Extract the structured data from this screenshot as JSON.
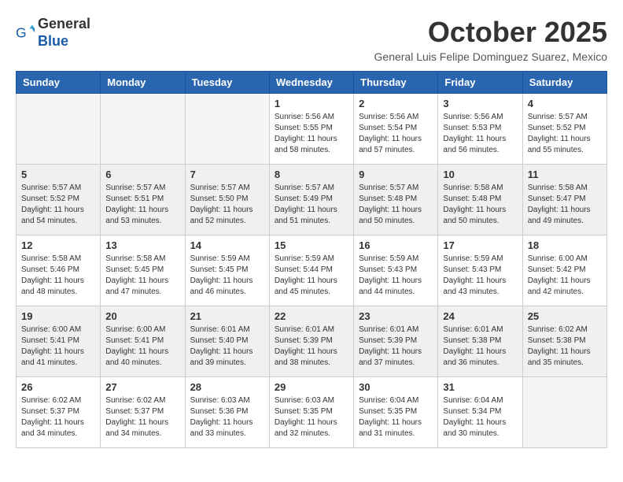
{
  "header": {
    "logo_general": "General",
    "logo_blue": "Blue",
    "calendar_title": "October 2025",
    "subtitle": "General Luis Felipe Dominguez Suarez, Mexico"
  },
  "weekdays": [
    "Sunday",
    "Monday",
    "Tuesday",
    "Wednesday",
    "Thursday",
    "Friday",
    "Saturday"
  ],
  "weeks": [
    [
      {
        "day": "",
        "info": ""
      },
      {
        "day": "",
        "info": ""
      },
      {
        "day": "",
        "info": ""
      },
      {
        "day": "1",
        "info": "Sunrise: 5:56 AM\nSunset: 5:55 PM\nDaylight: 11 hours\nand 58 minutes."
      },
      {
        "day": "2",
        "info": "Sunrise: 5:56 AM\nSunset: 5:54 PM\nDaylight: 11 hours\nand 57 minutes."
      },
      {
        "day": "3",
        "info": "Sunrise: 5:56 AM\nSunset: 5:53 PM\nDaylight: 11 hours\nand 56 minutes."
      },
      {
        "day": "4",
        "info": "Sunrise: 5:57 AM\nSunset: 5:52 PM\nDaylight: 11 hours\nand 55 minutes."
      }
    ],
    [
      {
        "day": "5",
        "info": "Sunrise: 5:57 AM\nSunset: 5:52 PM\nDaylight: 11 hours\nand 54 minutes."
      },
      {
        "day": "6",
        "info": "Sunrise: 5:57 AM\nSunset: 5:51 PM\nDaylight: 11 hours\nand 53 minutes."
      },
      {
        "day": "7",
        "info": "Sunrise: 5:57 AM\nSunset: 5:50 PM\nDaylight: 11 hours\nand 52 minutes."
      },
      {
        "day": "8",
        "info": "Sunrise: 5:57 AM\nSunset: 5:49 PM\nDaylight: 11 hours\nand 51 minutes."
      },
      {
        "day": "9",
        "info": "Sunrise: 5:57 AM\nSunset: 5:48 PM\nDaylight: 11 hours\nand 50 minutes."
      },
      {
        "day": "10",
        "info": "Sunrise: 5:58 AM\nSunset: 5:48 PM\nDaylight: 11 hours\nand 50 minutes."
      },
      {
        "day": "11",
        "info": "Sunrise: 5:58 AM\nSunset: 5:47 PM\nDaylight: 11 hours\nand 49 minutes."
      }
    ],
    [
      {
        "day": "12",
        "info": "Sunrise: 5:58 AM\nSunset: 5:46 PM\nDaylight: 11 hours\nand 48 minutes."
      },
      {
        "day": "13",
        "info": "Sunrise: 5:58 AM\nSunset: 5:45 PM\nDaylight: 11 hours\nand 47 minutes."
      },
      {
        "day": "14",
        "info": "Sunrise: 5:59 AM\nSunset: 5:45 PM\nDaylight: 11 hours\nand 46 minutes."
      },
      {
        "day": "15",
        "info": "Sunrise: 5:59 AM\nSunset: 5:44 PM\nDaylight: 11 hours\nand 45 minutes."
      },
      {
        "day": "16",
        "info": "Sunrise: 5:59 AM\nSunset: 5:43 PM\nDaylight: 11 hours\nand 44 minutes."
      },
      {
        "day": "17",
        "info": "Sunrise: 5:59 AM\nSunset: 5:43 PM\nDaylight: 11 hours\nand 43 minutes."
      },
      {
        "day": "18",
        "info": "Sunrise: 6:00 AM\nSunset: 5:42 PM\nDaylight: 11 hours\nand 42 minutes."
      }
    ],
    [
      {
        "day": "19",
        "info": "Sunrise: 6:00 AM\nSunset: 5:41 PM\nDaylight: 11 hours\nand 41 minutes."
      },
      {
        "day": "20",
        "info": "Sunrise: 6:00 AM\nSunset: 5:41 PM\nDaylight: 11 hours\nand 40 minutes."
      },
      {
        "day": "21",
        "info": "Sunrise: 6:01 AM\nSunset: 5:40 PM\nDaylight: 11 hours\nand 39 minutes."
      },
      {
        "day": "22",
        "info": "Sunrise: 6:01 AM\nSunset: 5:39 PM\nDaylight: 11 hours\nand 38 minutes."
      },
      {
        "day": "23",
        "info": "Sunrise: 6:01 AM\nSunset: 5:39 PM\nDaylight: 11 hours\nand 37 minutes."
      },
      {
        "day": "24",
        "info": "Sunrise: 6:01 AM\nSunset: 5:38 PM\nDaylight: 11 hours\nand 36 minutes."
      },
      {
        "day": "25",
        "info": "Sunrise: 6:02 AM\nSunset: 5:38 PM\nDaylight: 11 hours\nand 35 minutes."
      }
    ],
    [
      {
        "day": "26",
        "info": "Sunrise: 6:02 AM\nSunset: 5:37 PM\nDaylight: 11 hours\nand 34 minutes."
      },
      {
        "day": "27",
        "info": "Sunrise: 6:02 AM\nSunset: 5:37 PM\nDaylight: 11 hours\nand 34 minutes."
      },
      {
        "day": "28",
        "info": "Sunrise: 6:03 AM\nSunset: 5:36 PM\nDaylight: 11 hours\nand 33 minutes."
      },
      {
        "day": "29",
        "info": "Sunrise: 6:03 AM\nSunset: 5:35 PM\nDaylight: 11 hours\nand 32 minutes."
      },
      {
        "day": "30",
        "info": "Sunrise: 6:04 AM\nSunset: 5:35 PM\nDaylight: 11 hours\nand 31 minutes."
      },
      {
        "day": "31",
        "info": "Sunrise: 6:04 AM\nSunset: 5:34 PM\nDaylight: 11 hours\nand 30 minutes."
      },
      {
        "day": "",
        "info": ""
      }
    ]
  ]
}
